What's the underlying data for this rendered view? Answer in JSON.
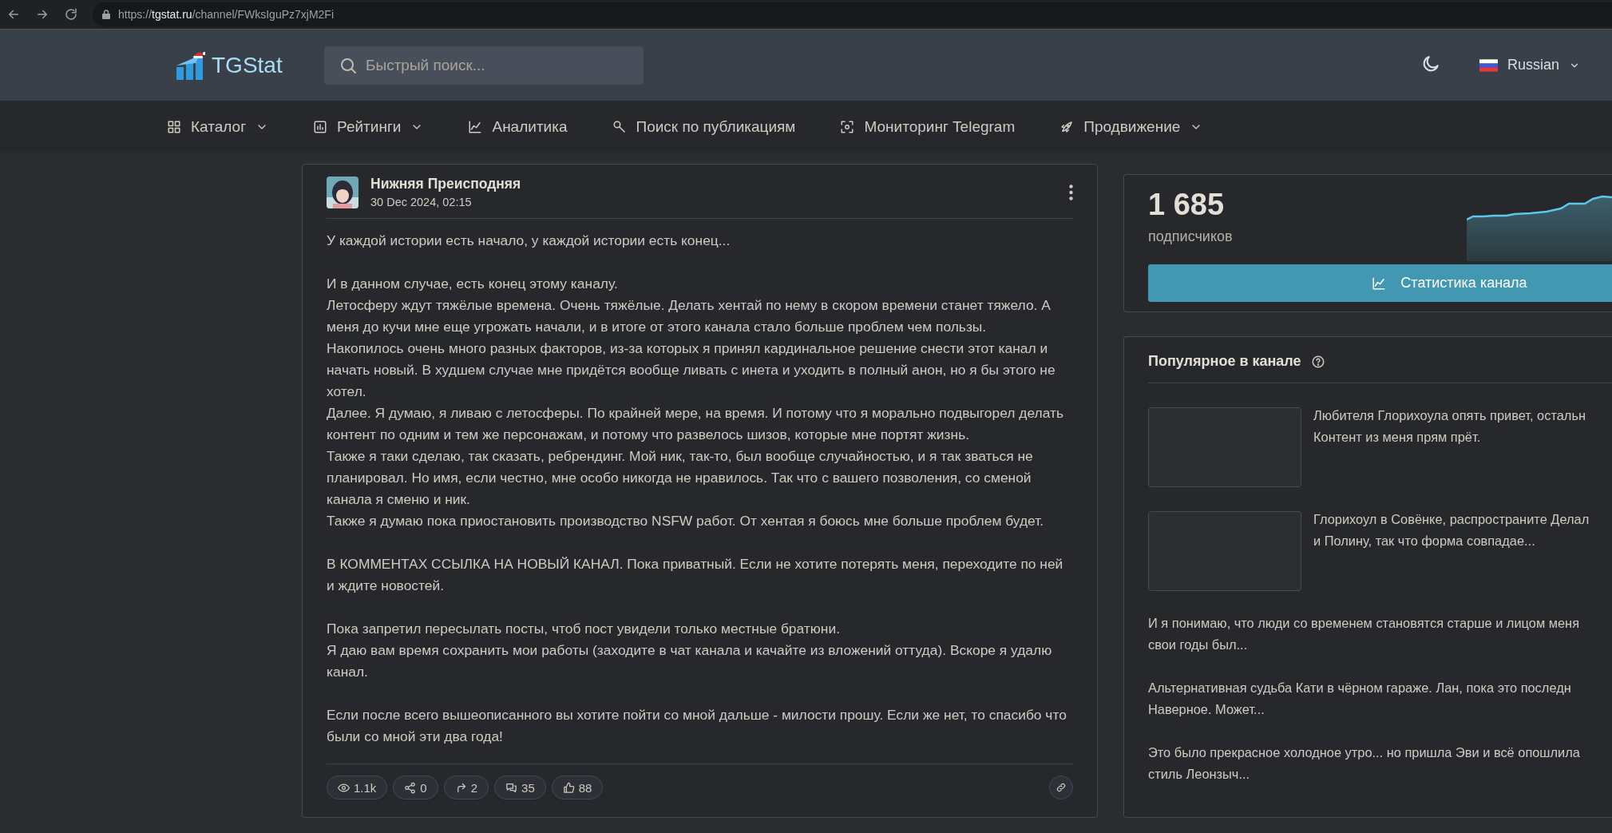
{
  "browser": {
    "url": "https://**tgstat.ru**/channel/FWksIguPz7xjM2Fi"
  },
  "header": {
    "logo": "TGStat",
    "search": {
      "placeholder": "Быстрый поиск..."
    },
    "language": "Russian"
  },
  "nav": [
    {
      "kind": "grid",
      "label": "Каталог",
      "dropdown": true
    },
    {
      "kind": "bars",
      "label": "Рейтинги",
      "dropdown": true
    },
    {
      "kind": "line",
      "label": "Аналитика",
      "dropdown": false
    },
    {
      "kind": "search",
      "label": "Поиск по публикациям",
      "dropdown": false
    },
    {
      "kind": "scan",
      "label": "Мониторинг Telegram",
      "dropdown": false
    },
    {
      "kind": "rocket",
      "label": "Продвижение",
      "dropdown": true
    }
  ],
  "post": {
    "channel": "Нижняя Преисподняя",
    "date": "30 Dec 2024, 02:15",
    "paragraphs": [
      "У каждой истории есть начало, у каждой истории есть конец...",
      "И в данном случае, есть конец этому каналу.\nЛетосферу ждут тяжёлые времена. Очень тяжёлые. Делать хентай по нему в скором времени станет тяжело. А меня до кучи мне еще угрожать начали, и в итоге от этого канала стало больше проблем чем пользы.\nНакопилось очень много разных факторов, из-за которых я принял кардинальное решение снести этот канал и начать новый. В худшем случае мне придётся вообще ливать с инета и уходить в полный анон, но я бы этого не хотел.\nДалее. Я думаю, я ливаю с летосферы. По крайней мере, на время. И потому что я морально подвыгорел делать контент по одним и тем же персонажам, и потому что развелось шизов, которые мне портят жизнь.\nТакже я таки сделаю, так сказать, ребрендинг. Мой ник, так-то, был вообще случайностью, и я так зваться не планировал. Но имя, если честно, мне особо никогда не нравилось. Так что с вашего позволения, со сменой канала я сменю и ник.\nТакже я думаю пока приостановить производство NSFW работ. От хентая я боюсь мне больше проблем будет.",
      "В КОММЕНТАХ ССЫЛКА НА НОВЫЙ КАНАЛ. Пока приватный. Если не хотите потерять меня, переходите по ней и ждите новостей.",
      "Пока запретил пересылать посты, чтоб пост увидели только местные братюни.\nЯ даю вам время сохранить мои работы (заходите в чат канала и качайте из вложений оттуда). Вскоре я удалю канал.",
      "Если после всего вышеописанного вы хотите пойти со мной дальше - милости прошу. Если же нет, то спасибо что были со мной эти два года!"
    ],
    "stats": [
      {
        "kind": "views",
        "value": "1.1k"
      },
      {
        "kind": "shares",
        "value": "0"
      },
      {
        "kind": "forwards",
        "value": "2"
      },
      {
        "kind": "comments",
        "value": "35"
      },
      {
        "kind": "reactions",
        "value": "88"
      }
    ]
  },
  "subscribers": {
    "count": "1 685",
    "label": "подписчиков",
    "button": "Статистика канала"
  },
  "popular": {
    "title": "Популярное в канале",
    "items": [
      {
        "kind": "thumb",
        "text": "Любителя Глорихоула опять привет, остальн\nКонтент из меня прям прёт."
      },
      {
        "kind": "thumb",
        "text": "Глорихоул в Совёнке, распространите Делал\nи Полину, так что форма совпадае..."
      },
      {
        "kind": "text",
        "text": "И я понимаю, что люди со временем становятся старше и лицом меня\nсвои годы был..."
      },
      {
        "kind": "text",
        "text": "Альтернативная судьба Кати в чёрном гараже. Лан, пока это последн\nНаверное. Может..."
      },
      {
        "kind": "text",
        "text": "Это было прекрасное холодное утро... но пришла Эви и всё опошлила\nстиль Леонзыч..."
      }
    ]
  }
}
